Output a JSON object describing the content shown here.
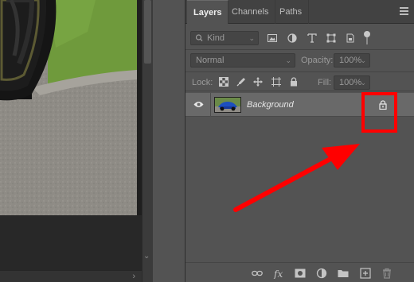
{
  "tabs": [
    {
      "label": "Layers",
      "active": true
    },
    {
      "label": "Channels",
      "active": false
    },
    {
      "label": "Paths",
      "active": false
    }
  ],
  "filter": {
    "kind_label": "Kind"
  },
  "blend": {
    "mode": "Normal",
    "opacity_label": "Opacity:",
    "opacity_value": "100%"
  },
  "lock": {
    "label": "Lock:",
    "fill_label": "Fill:",
    "fill_value": "100%"
  },
  "layer": {
    "name": "Background",
    "visible": true,
    "locked": true
  },
  "icons": {
    "filter_icons": [
      "image-filter-icon",
      "adjustment-filter-icon",
      "type-filter-icon",
      "shape-filter-icon",
      "smart-object-filter-icon",
      "filter-toggle-icon"
    ],
    "lock_icons": [
      "lock-transparent-icon",
      "lock-image-icon",
      "lock-position-icon",
      "lock-artboard-icon",
      "lock-all-icon"
    ],
    "bottom_icons": [
      "link-layers-icon",
      "fx-icon",
      "mask-icon",
      "adjustment-layer-icon",
      "group-folder-icon",
      "new-layer-icon",
      "delete-icon"
    ]
  },
  "colors": {
    "highlight": "#ff0000",
    "panel": "#535353",
    "selected_row": "#696969"
  }
}
